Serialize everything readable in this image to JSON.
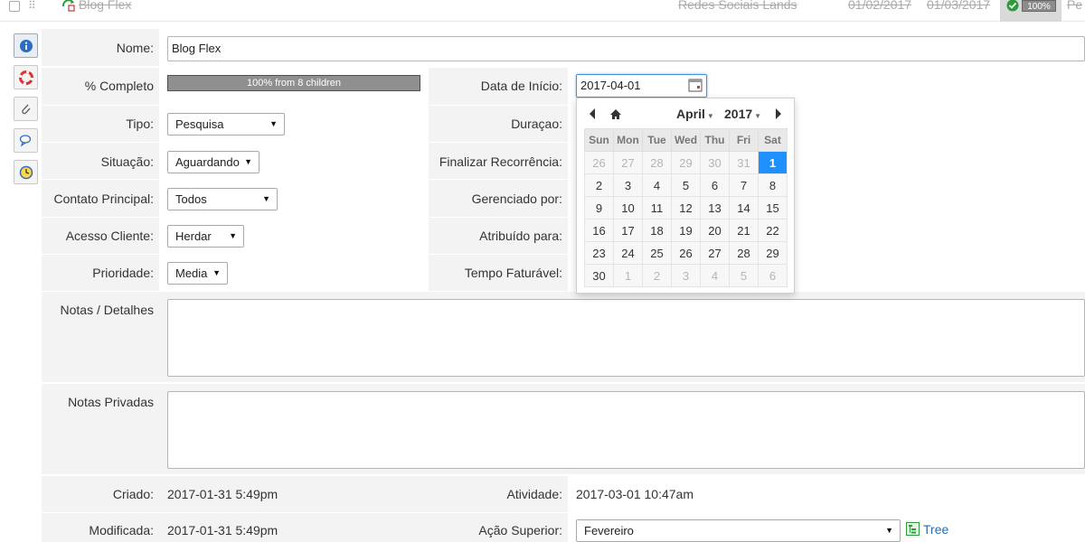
{
  "top": {
    "title": "Blog Flex",
    "group": "Redes Sociais Lands",
    "start_date": "01/02/2017",
    "end_date": "01/03/2017",
    "progress": "100%",
    "more": "Pe"
  },
  "form": {
    "nome_label": "Nome:",
    "nome_value": "Blog Flex",
    "completo_label": "% Completo",
    "completo_bar": "100% from 8 children",
    "completo_fraction": 1.0,
    "data_inicio_label": "Data de Início:",
    "data_inicio_value": "2017-04-01",
    "tipo_label": "Tipo:",
    "tipo_value": "Pesquisa",
    "duracao_label": "Duraçao:",
    "situacao_label": "Situação:",
    "situacao_value": "Aguardando",
    "finalizar_label": "Finalizar Recorrência:",
    "contato_label": "Contato Principal:",
    "contato_value": "Todos",
    "gerenciado_label": "Gerenciado por:",
    "acesso_label": "Acesso Cliente:",
    "acesso_value": "Herdar",
    "atribuido_label": "Atribuído para:",
    "prioridade_label": "Prioridade:",
    "prioridade_value": "Media",
    "tempo_label": "Tempo Faturável:",
    "notas_label": "Notas / Detalhes",
    "notas_privadas_label": "Notas Privadas",
    "criado_label": "Criado:",
    "criado_value": "2017-01-31 5:49pm",
    "atividade_label": "Atividade:",
    "atividade_value": "2017-03-01 10:47am",
    "modificada_label": "Modificada:",
    "modificada_value": "2017-01-31 5:49pm",
    "acao_label": "Ação Superior:",
    "acao_value": "Fevereiro",
    "tree_label": "Tree"
  },
  "datepicker": {
    "month": "April",
    "year": "2017",
    "weekdays": [
      "Sun",
      "Mon",
      "Tue",
      "Wed",
      "Thu",
      "Fri",
      "Sat"
    ],
    "weeks": [
      [
        "26",
        "27",
        "28",
        "29",
        "30",
        "31",
        "1"
      ],
      [
        "2",
        "3",
        "4",
        "5",
        "6",
        "7",
        "8"
      ],
      [
        "9",
        "10",
        "11",
        "12",
        "13",
        "14",
        "15"
      ],
      [
        "16",
        "17",
        "18",
        "19",
        "20",
        "21",
        "22"
      ],
      [
        "23",
        "24",
        "25",
        "26",
        "27",
        "28",
        "29"
      ],
      [
        "30",
        "1",
        "2",
        "3",
        "4",
        "5",
        "6"
      ]
    ],
    "selected_day": "1"
  },
  "side_icons": [
    "info-icon",
    "lifebuoy-icon",
    "paperclip-icon",
    "comments-icon",
    "clock-icon"
  ],
  "colors": {
    "selected_day": "#1e90ff",
    "progress_fill": "#8f8f8f",
    "row_background": "#f3f3f3",
    "link": "#2a6db0"
  }
}
